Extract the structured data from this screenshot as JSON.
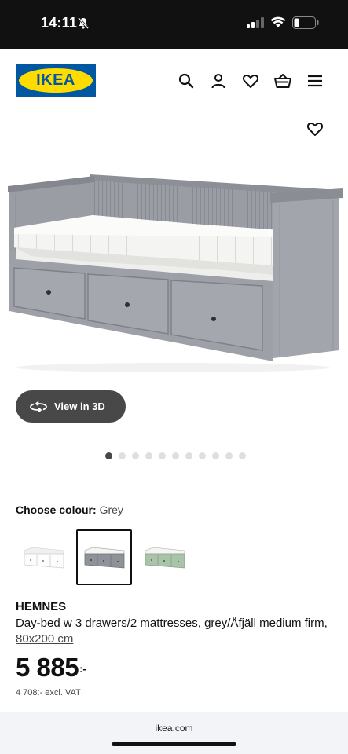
{
  "status_bar": {
    "time": "14:11"
  },
  "header": {
    "logo_text": "IKEA"
  },
  "view3d": {
    "label": "View in 3D"
  },
  "carousel": {
    "count": 11,
    "active_index": 0
  },
  "colour": {
    "label": "Choose colour:",
    "selected": "Grey"
  },
  "swatches": [
    "white",
    "grey",
    "green"
  ],
  "product": {
    "name": "HEMNES",
    "description": "Day-bed w 3 drawers/2 mattresses, grey/Åfjäll medium firm,",
    "size_link": "80x200 cm",
    "price": "5 885",
    "price_suffix": ":-",
    "price_excl_vat": "4 708:- excl. VAT"
  },
  "browser": {
    "url": "ikea.com"
  },
  "colors": {
    "ikea_blue": "#0058a3",
    "ikea_yellow": "#ffdb00",
    "button_dark": "#484848",
    "bed_grey": "#8f9399"
  }
}
